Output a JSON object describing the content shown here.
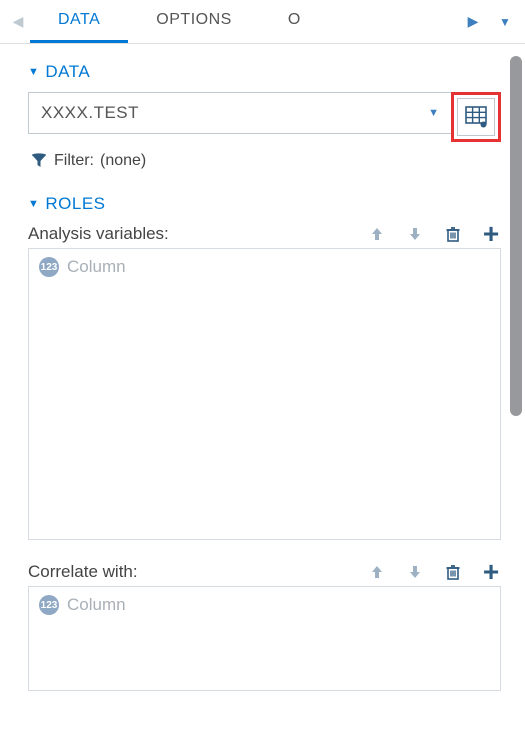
{
  "tabs": {
    "items": [
      "DATA",
      "OPTIONS",
      "O"
    ],
    "active": 0
  },
  "sections": {
    "data": {
      "title": "DATA"
    },
    "roles": {
      "title": "ROLES"
    }
  },
  "data_select": {
    "value": "XXXX.TEST"
  },
  "filter": {
    "label": "Filter:",
    "value": "(none)"
  },
  "roles": {
    "analysis": {
      "title": "Analysis variables:",
      "placeholder": "Column",
      "icon_label": "123"
    },
    "correlate": {
      "title": "Correlate with:",
      "placeholder": "Column",
      "icon_label": "123"
    }
  }
}
